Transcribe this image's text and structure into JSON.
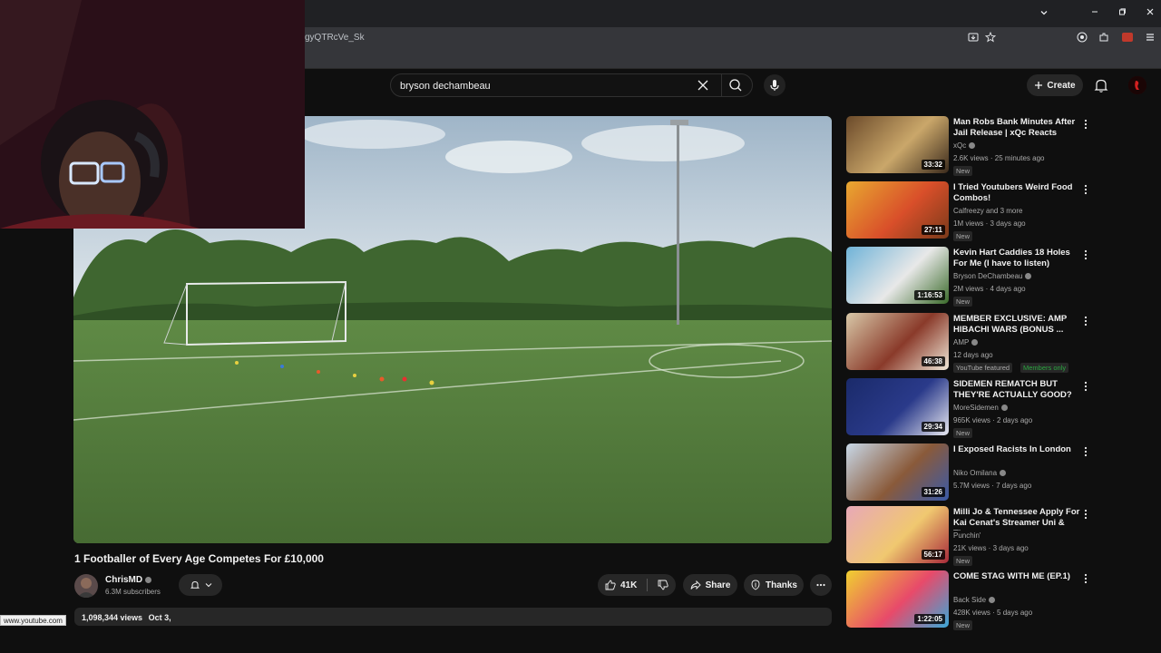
{
  "browser": {
    "url_fragment": "gyQTRcVe_Sk",
    "status_url": "www.youtube.com"
  },
  "search": {
    "value": "bryson dechambeau"
  },
  "header": {
    "create_label": "Create"
  },
  "video": {
    "title": "1 Footballer of Every Age Competes For £10,000",
    "channel": "ChrisMD",
    "subscribers": "6.3M subscribers",
    "likes": "41K",
    "share_label": "Share",
    "thanks_label": "Thanks",
    "views": "1,098,344 views",
    "date": "Oct 3,"
  },
  "recommendations": [
    {
      "title": "Man Robs Bank Minutes After Jail Release | xQc Reacts",
      "channel": "xQc",
      "verified": true,
      "views": "2.6K views · 25 minutes ago",
      "badge": "New",
      "duration": "33:32",
      "thumb_colors": [
        "#6b4a2a",
        "#caa76a",
        "#3b2a1c"
      ]
    },
    {
      "title": "I Tried Youtubers Weird Food Combos!",
      "channel": "Calfreezy and 3 more",
      "verified": false,
      "views": "1M views · 3 days ago",
      "badge": "New",
      "duration": "27:11",
      "thumb_colors": [
        "#e8a830",
        "#d94f2a",
        "#7a3a1a"
      ]
    },
    {
      "title": "Kevin Hart Caddies 18 Holes For Me (I have to listen)",
      "channel": "Bryson DeChambeau",
      "verified": true,
      "views": "2M views · 4 days ago",
      "badge": "New",
      "duration": "1:16:53",
      "thumb_colors": [
        "#6fb3d8",
        "#e8e8e8",
        "#3a6a2a"
      ]
    },
    {
      "title": "MEMBER EXCLUSIVE: AMP HIBACHI WARS (BONUS ...",
      "channel": "AMP",
      "verified": true,
      "views": "12 days ago",
      "badge": "YouTube featured",
      "badge2": "Members only",
      "duration": "46:38",
      "thumb_colors": [
        "#d8c8a8",
        "#8a3a2a",
        "#f0e8d8"
      ]
    },
    {
      "title": "SIDEMEN REMATCH BUT THEY'RE ACTUALLY GOOD?",
      "channel": "MoreSidemen",
      "verified": true,
      "views": "965K views · 2 days ago",
      "badge": "New",
      "duration": "29:34",
      "thumb_colors": [
        "#1a2a6a",
        "#2a3a8a",
        "#e8e8f0"
      ]
    },
    {
      "title": "I Exposed Racists In London",
      "channel": "Niko Omilana",
      "verified": true,
      "views": "5.7M views · 7 days ago",
      "badge": "",
      "duration": "31:26",
      "thumb_colors": [
        "#c8d8e8",
        "#8a5a3a",
        "#3a5aa8"
      ]
    },
    {
      "title": "Milli Jo & Tennessee Apply For Kai Cenat's Streamer Uni & Th...",
      "channel": "Punchin'",
      "verified": false,
      "views": "21K views · 3 days ago",
      "badge": "New",
      "duration": "56:17",
      "thumb_colors": [
        "#e8a8b8",
        "#f0c870",
        "#a82a3a"
      ]
    },
    {
      "title": "COME STAG WITH ME (EP.1)",
      "channel": "Back Side",
      "verified": true,
      "views": "428K views · 5 days ago",
      "badge": "New",
      "duration": "1:22:05",
      "thumb_colors": [
        "#f0d030",
        "#e84a6a",
        "#3aa8d8"
      ]
    }
  ],
  "icons": {
    "menu": "kebab-icon",
    "like": "thumbs-up-icon",
    "dislike": "thumbs-down-icon",
    "share": "share-icon",
    "thanks": "thanks-icon",
    "bell": "bell-icon",
    "mic": "mic-icon",
    "search": "search-icon",
    "clear": "close-icon"
  },
  "colors": {
    "members_badge": "#2ba640",
    "background": "#0f0f0f",
    "surface": "#272727"
  }
}
